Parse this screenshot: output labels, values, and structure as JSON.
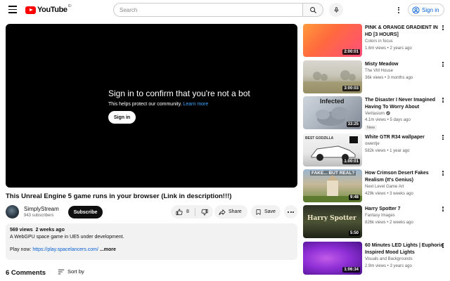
{
  "header": {
    "logo_text": "YouTube",
    "logo_country": "ID",
    "search_placeholder": "Search",
    "signin_label": "Sign in"
  },
  "player": {
    "bot_title": "Sign in to confirm that you're not a bot",
    "bot_subtitle": "This helps protect our community.",
    "learn_more": "Learn more",
    "signin_button": "Sign in"
  },
  "video": {
    "title": "This Unreal Engine 5 game runs in your browser (Link in description!!!)",
    "channel": "SimplyStream",
    "subscribers": "943 subscribers",
    "subscribe_label": "Subscribe",
    "likes": "8",
    "share_label": "Share",
    "save_label": "Save"
  },
  "description": {
    "views": "569 views",
    "age": "2 weeks ago",
    "line1": "A WebGPU space game in UE5 under development.",
    "play_prefix": "Play now:",
    "link": "https://play.spacelancers.com/",
    "more": "...more"
  },
  "comments": {
    "count_label": "6 Comments",
    "sort_label": "Sort by"
  },
  "sidebar": {
    "items": [
      {
        "title": "PINK & ORANGE GRADIENT IN HD [3 HOURS]",
        "channel": "Colors in focus",
        "meta": "1.6m views • 2 years ago",
        "duration": "2:00:01",
        "thumb_colors": [
          "#ff9a3c",
          "#ff4f7b"
        ]
      },
      {
        "title": "Misty Meadow",
        "channel": "The VM House",
        "meta": "36k views • 3 months ago",
        "duration": "3:00:03",
        "thumb_colors": [
          "#d8d6cf",
          "#8c8764"
        ]
      },
      {
        "title": "The Disaster I Never Imagined Having To Worry About",
        "channel": "Veritasium",
        "meta": "4.1m views • 5 days ago",
        "badge": "New",
        "duration": "33:25",
        "thumb_text": "Infected",
        "thumb_colors": [
          "#cfd6de",
          "#7f8894"
        ]
      },
      {
        "title": "White GTR R34 wallpaper",
        "channel": "owentje",
        "meta": "582k views • 1 year ago",
        "duration": "1:00:01",
        "thumb_text": "BEST GODZILLA",
        "thumb_colors": [
          "#f4f4f4",
          "#bdbdbd"
        ]
      },
      {
        "title": "How Crimson Desert Fakes Realism (It's Genius)",
        "channel": "Next Level Game Art",
        "meta": "429k views • 3 weeks ago",
        "duration": "9:48",
        "thumb_text": "FAKE... BUT REAL?",
        "thumb_colors": [
          "#9ab6cf",
          "#6f8d3f"
        ]
      },
      {
        "title": "Harry Spotter 7",
        "channel": "Fantasy Images",
        "meta": "826k views • 2 weeks ago",
        "duration": "5:50",
        "thumb_text": "Harry Spotter",
        "thumb_colors": [
          "#2b3024",
          "#1e2218"
        ]
      },
      {
        "title": "60 Minutes LED Lights | Euphoria Inspired Mood Lights",
        "channel": "Visuals and Backgrounds",
        "meta": "2.9m views • 3 years ago",
        "duration": "1:06:34",
        "thumb_colors": [
          "#c25be8",
          "#4a118a"
        ]
      }
    ]
  }
}
